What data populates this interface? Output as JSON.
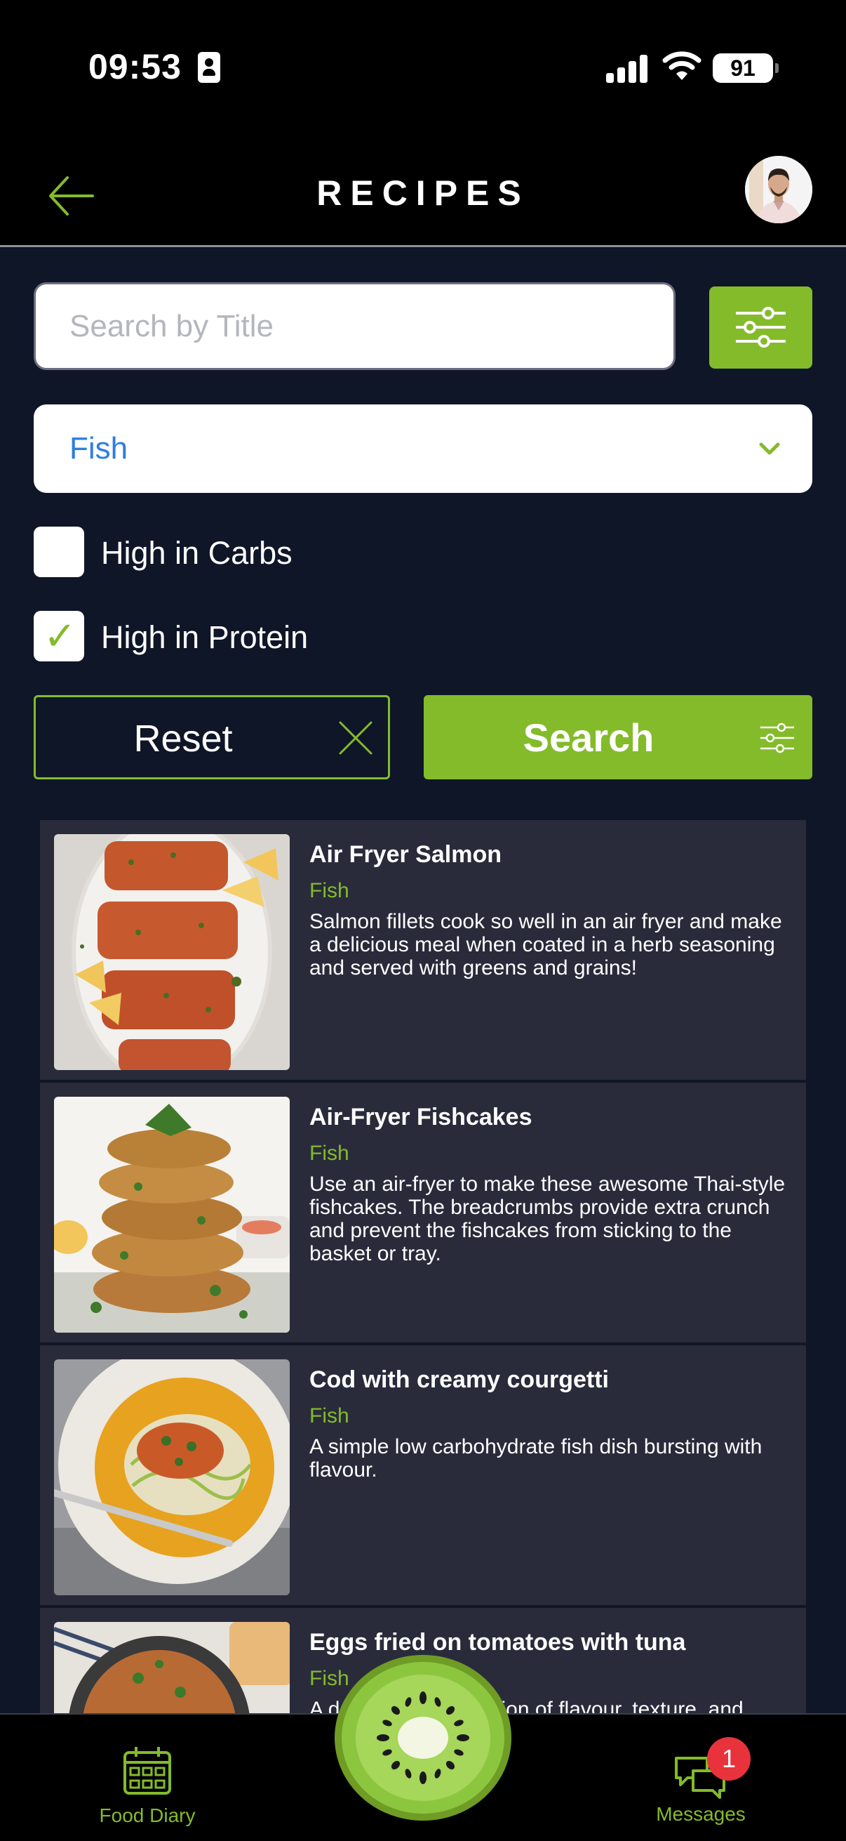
{
  "status_bar": {
    "time": "09:53",
    "battery": "91"
  },
  "header": {
    "title": "RECIPES"
  },
  "search": {
    "placeholder": "Search by Title",
    "value": ""
  },
  "category": {
    "selected": "Fish"
  },
  "checkboxes": [
    {
      "label": "High in Carbs",
      "checked": false
    },
    {
      "label": "High in Protein",
      "checked": true
    }
  ],
  "actions": {
    "reset_label": "Reset",
    "search_label": "Search"
  },
  "recipes": [
    {
      "title": "Air Fryer Salmon",
      "category": "Fish",
      "description": "Salmon fillets cook so well in an air fryer and make a delicious meal when coated in a herb seasoning and served with greens and grains!"
    },
    {
      "title": "Air-Fryer Fishcakes",
      "category": "Fish",
      "description": "Use an air-fryer to make these awesome Thai-style fishcakes. The breadcrumbs provide extra crunch and prevent the fishcakes from sticking to the basket or tray."
    },
    {
      "title": "Cod with creamy courgetti",
      "category": "Fish",
      "description": "A simple low carbohydrate fish dish bursting with flavour."
    },
    {
      "title": "Eggs fried on tomatoes with tuna",
      "category": "Fish",
      "description": "A delicious combination of flavour, texture, and"
    }
  ],
  "bottom_nav": {
    "food_diary": "Food Diary",
    "messages": "Messages",
    "messages_badge": "1"
  },
  "colors": {
    "accent": "#84bb2a",
    "background": "#0f1628",
    "card": "#292b3b",
    "link_blue": "#2f7de0",
    "badge": "#e8333d"
  }
}
